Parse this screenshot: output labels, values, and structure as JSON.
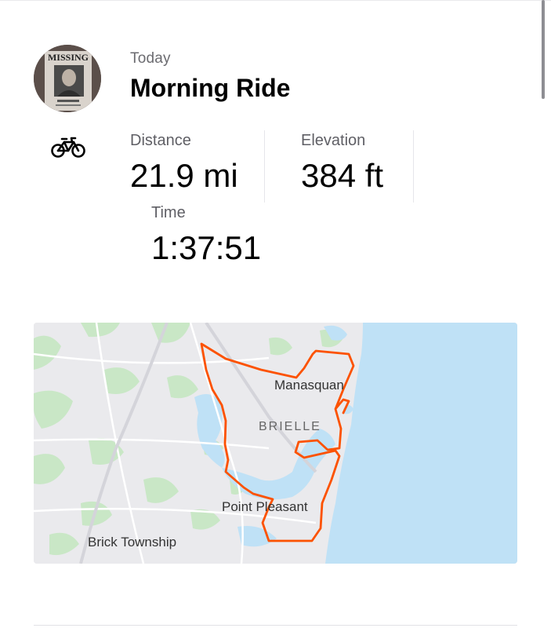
{
  "activity": {
    "date_label": "Today",
    "title": "Morning Ride",
    "sport_icon": "bicycle-icon",
    "avatar_icon": "profile-photo"
  },
  "stats": [
    {
      "label": "Distance",
      "value": "21.9 mi"
    },
    {
      "label": "Elevation",
      "value": "384 ft"
    },
    {
      "label": "Time",
      "value": "1:37:51"
    }
  ],
  "map": {
    "labels": {
      "manasquan": "Manasquan",
      "brielle": "BRIELLE",
      "point_pleasant": "Point Pleasant",
      "brick": "Brick Township"
    },
    "route_color": "#fc5200",
    "water_color": "#bfe1f6",
    "land_color": "#eaeaed",
    "park_color": "#c9e7c6"
  }
}
